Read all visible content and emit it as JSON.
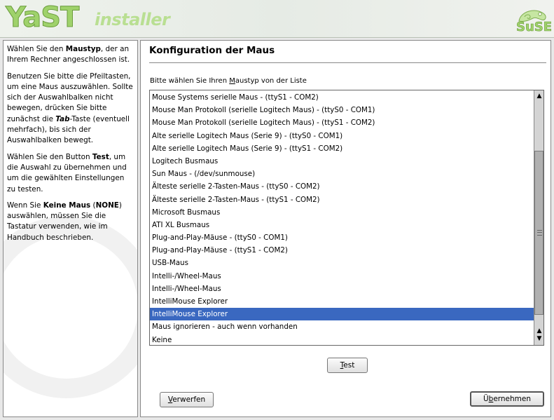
{
  "banner": {
    "logo_primary": "YaST",
    "logo_secondary": "installer",
    "brand": "SuSE"
  },
  "help": {
    "paragraphs": [
      [
        "Wählen Sie den ",
        {
          "b": "Maustyp"
        },
        ", der an Ihrem Rechner angeschlossen ist."
      ],
      [
        "Benutzen Sie bitte die Pfeiltasten, um eine Maus auszuwählen. Sollte sich der Auswahlbalken nicht bewegen, drücken Sie bitte zunächst die ",
        {
          "bi": "Tab"
        },
        "-Taste (eventuell mehrfach), bis sich der Auswahlbalken bewegt."
      ],
      [
        "Wählen Sie den Button ",
        {
          "b": "Test"
        },
        ", um die Auswahl zu übernehmen und um die gewählten Einstellungen zu testen."
      ],
      [
        "Wenn Sie ",
        {
          "b": "Keine Maus"
        },
        " (",
        {
          "b": "NONE"
        },
        ") auswählen, müssen Sie die Tastatur verwenden, wie im Handbuch beschrieben."
      ]
    ]
  },
  "main": {
    "title": "Konfiguration der Maus",
    "list_label_pre": "Bitte wählen Sie Ihren ",
    "list_label_ul": "M",
    "list_label_post": "austyp von der Liste",
    "items": [
      "Mouse Systems serielle Maus - (ttyS1 - COM2)",
      "Mouse Man Protokoll (serielle Logitech Maus) - (ttyS0 - COM1)",
      "Mouse Man Protokoll (serielle Logitech Maus) - (ttyS1 - COM2)",
      "Alte serielle Logitech Maus (Serie 9) - (ttyS0 - COM1)",
      "Alte serielle Logitech Maus (Serie 9) - (ttyS1 - COM2)",
      "Logitech Busmaus",
      "Sun Maus - (/dev/sunmouse)",
      "Älteste serielle 2-Tasten-Maus - (ttyS0 - COM2)",
      "Älteste serielle 2-Tasten-Maus - (ttyS1 - COM2)",
      "Microsoft Busmaus",
      "ATI XL Busmaus",
      "Plug-and-Play-Mäuse - (ttyS0 - COM1)",
      "Plug-and-Play-Mäuse - (ttyS1 - COM2)",
      "USB-Maus",
      "Intelli-/Wheel-Maus",
      "Intelli-/Wheel-Maus",
      "IntelliMouse Explorer",
      "IntelliMouse Explorer",
      "Maus ignorieren - auch wenn vorhanden",
      "Keine"
    ],
    "selected_index": 17,
    "test_button": {
      "ul": "T",
      "rest": "est"
    },
    "discard_button": {
      "ul": "V",
      "rest": "erwerfen"
    },
    "accept_button": {
      "pre": "Ü",
      "ul": "b",
      "rest": "ernehmen"
    }
  },
  "colors": {
    "selection": "#3a68c0",
    "logo_green": "#9fd26b"
  }
}
